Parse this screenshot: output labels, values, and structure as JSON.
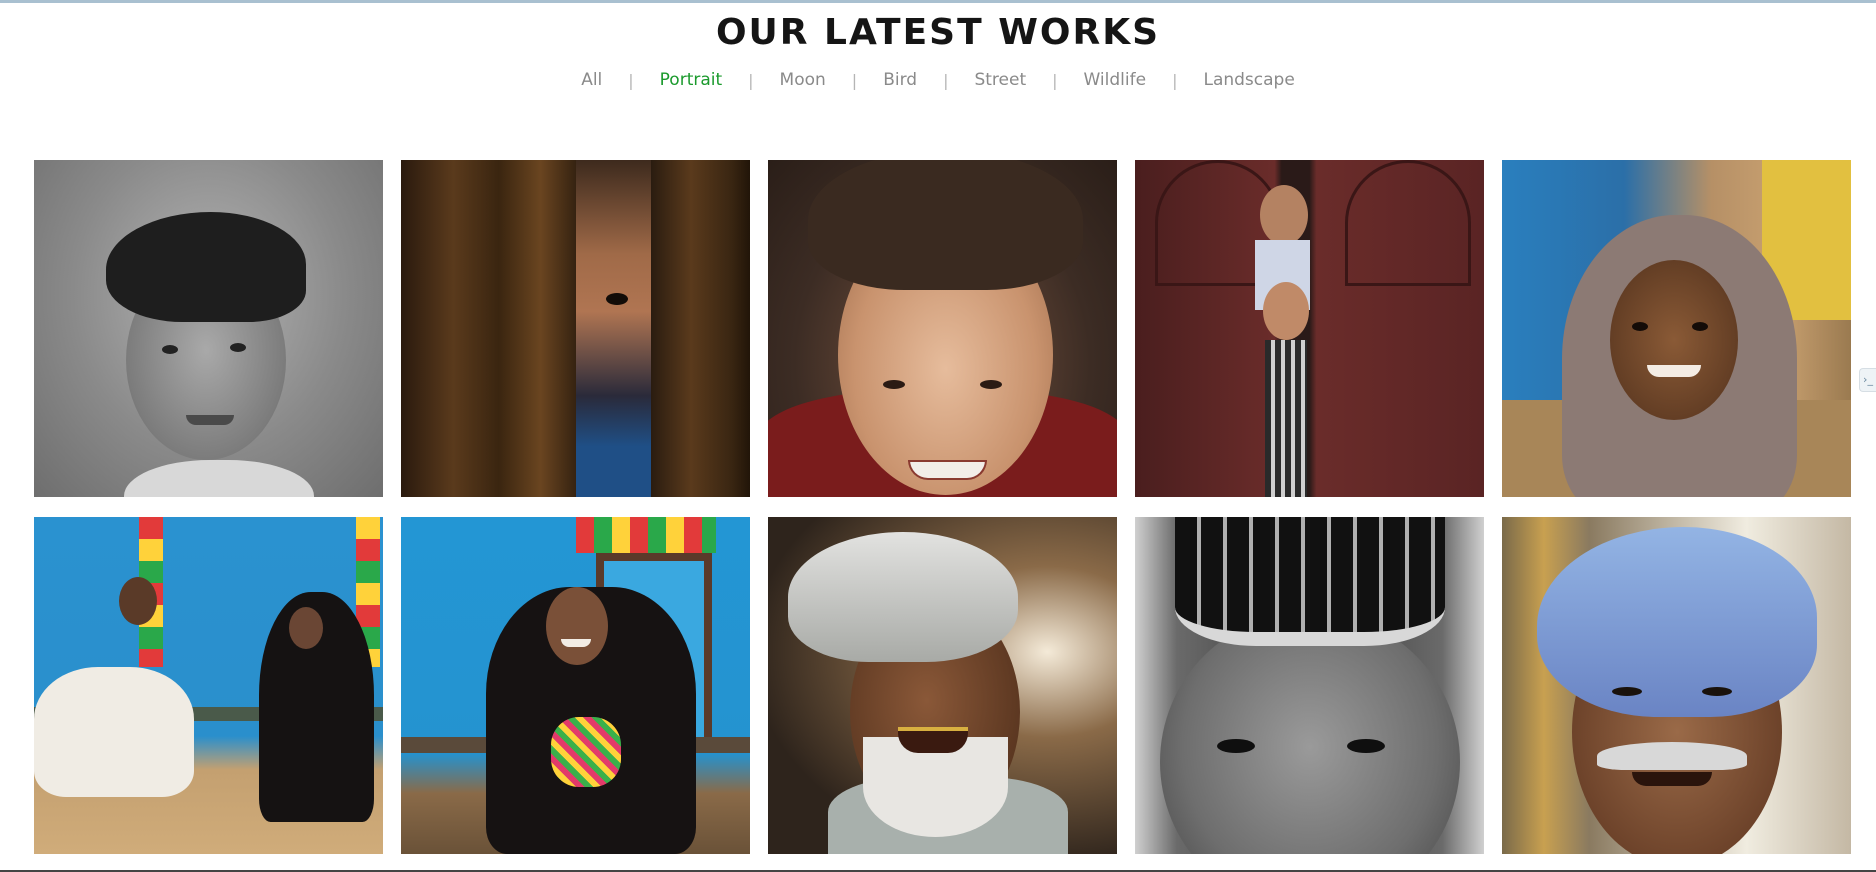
{
  "section": {
    "title": "OUR LATEST WORKS"
  },
  "filters": [
    {
      "label": "All",
      "active": false
    },
    {
      "label": "Portrait",
      "active": true
    },
    {
      "label": "Moon",
      "active": false
    },
    {
      "label": "Bird",
      "active": false
    },
    {
      "label": "Street",
      "active": false
    },
    {
      "label": "Wildlife",
      "active": false
    },
    {
      "label": "Landscape",
      "active": false
    }
  ],
  "filter_separator": "|",
  "gallery": {
    "category": "Portrait",
    "images": [
      {
        "subject": "boy-bw-portrait",
        "bg": "#8c8c8c"
      },
      {
        "subject": "child-behind-wooden-door",
        "bg": "#3b2a1a"
      },
      {
        "subject": "smiling-girl-closeup",
        "bg": "#4a3c30"
      },
      {
        "subject": "two-boys-at-red-door",
        "bg": "#5a2a28"
      },
      {
        "subject": "girl-in-hood-street",
        "bg": "#2a6ea0"
      },
      {
        "subject": "couple-on-bench-blue-wall",
        "bg": "#2a93d0"
      },
      {
        "subject": "woman-knitting-blue-wall",
        "bg": "#2396d4"
      },
      {
        "subject": "smiling-man-white-turban",
        "bg": "#3a3028"
      },
      {
        "subject": "man-kufi-bw-closeup",
        "bg": "#2c2c2c"
      },
      {
        "subject": "old-man-blue-turban",
        "bg": "#8a7060"
      }
    ]
  },
  "side_tab": {
    "icon": "arrow-tab-icon",
    "glyph": "›_"
  }
}
